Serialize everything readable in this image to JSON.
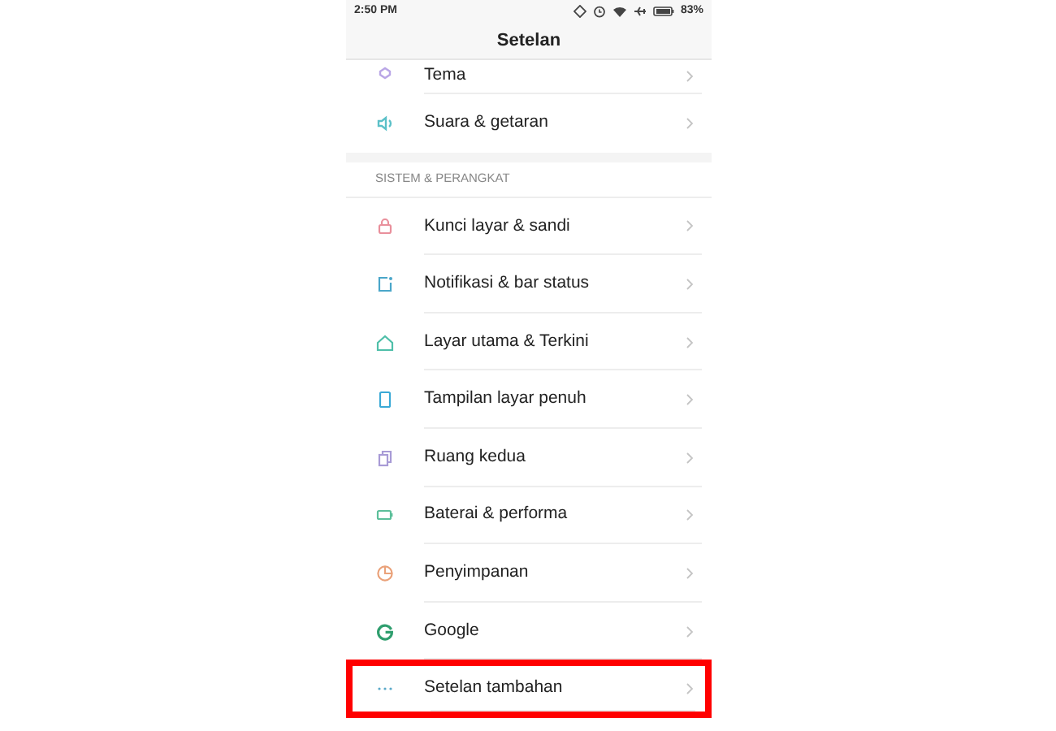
{
  "status_bar": {
    "time": "2:50 PM",
    "battery": "83%"
  },
  "title": "Setelan",
  "top_items": [
    {
      "label": "Tema",
      "color": "#b9a6e6"
    },
    {
      "label": "Suara & getaran",
      "color": "#5bc0c8"
    }
  ],
  "section": {
    "header": "SISTEM & PERANGKAT",
    "items": [
      {
        "label": "Kunci layar & sandi",
        "color": "#e9909c",
        "highlighted": false
      },
      {
        "label": "Notifikasi & bar status",
        "color": "#4aa6c9",
        "highlighted": false
      },
      {
        "label": "Layar utama & Terkini",
        "color": "#4fbfa9",
        "highlighted": false
      },
      {
        "label": "Tampilan layar penuh",
        "color": "#3aa9d6",
        "highlighted": false
      },
      {
        "label": "Ruang kedua",
        "color": "#a89bd6",
        "highlighted": false
      },
      {
        "label": "Baterai & performa",
        "color": "#5cbf9a",
        "highlighted": false
      },
      {
        "label": "Penyimpanan",
        "color": "#eaa27a",
        "highlighted": false
      },
      {
        "label": "Google",
        "color": "#2f9e6e",
        "highlighted": false
      },
      {
        "label": "Setelan tambahan",
        "color": "#5aa9c9",
        "highlighted": true
      }
    ]
  }
}
